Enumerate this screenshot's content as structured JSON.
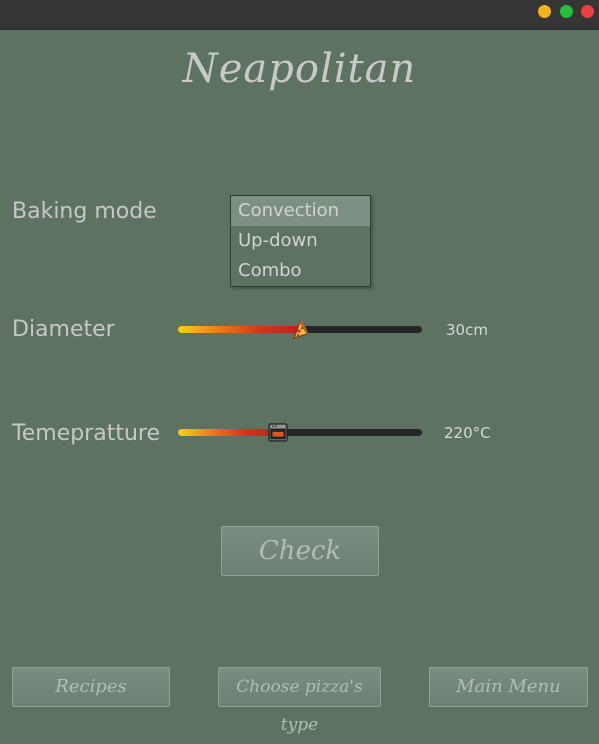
{
  "window": {
    "controls": {
      "minimize_color": "#f5b21a",
      "maximize_color": "#21c03a",
      "close_color": "#ee4040"
    }
  },
  "title": "Neapolitan",
  "baking_mode": {
    "label": "Baking mode",
    "options": [
      "Convection",
      "Up-down",
      "Combo"
    ],
    "selected": "Convection"
  },
  "diameter": {
    "label": "Diameter",
    "value_text": "30cm",
    "level": 0.5,
    "thumb_icon": "pizza-slice-icon"
  },
  "temperature": {
    "label": "Temepratture",
    "value_text": "220°C",
    "level": 0.41,
    "thumb_icon": "oven-icon"
  },
  "check_button": "Check",
  "bottom_nav": {
    "recipes": "Recipes",
    "choose": "Choose pizza's type",
    "main_menu": "Main Menu"
  },
  "colors": {
    "background": "#5e7262",
    "slider_gradient_start": "#f4d415",
    "slider_gradient_end": "#b8241c",
    "slider_track": "#262626"
  }
}
